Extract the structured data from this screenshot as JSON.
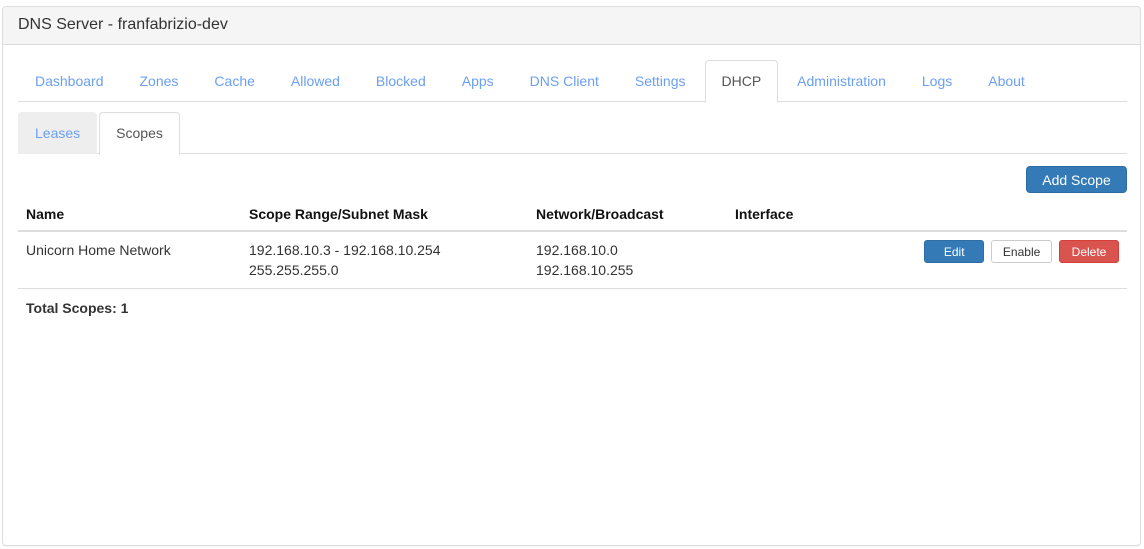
{
  "header": {
    "title": "DNS Server - franfabrizio-dev"
  },
  "main_tabs": [
    {
      "label": "Dashboard",
      "active": false
    },
    {
      "label": "Zones",
      "active": false
    },
    {
      "label": "Cache",
      "active": false
    },
    {
      "label": "Allowed",
      "active": false
    },
    {
      "label": "Blocked",
      "active": false
    },
    {
      "label": "Apps",
      "active": false
    },
    {
      "label": "DNS Client",
      "active": false
    },
    {
      "label": "Settings",
      "active": false
    },
    {
      "label": "DHCP",
      "active": true
    },
    {
      "label": "Administration",
      "active": false
    },
    {
      "label": "Logs",
      "active": false
    },
    {
      "label": "About",
      "active": false
    }
  ],
  "sub_tabs": [
    {
      "label": "Leases",
      "active": false
    },
    {
      "label": "Scopes",
      "active": true
    }
  ],
  "toolbar": {
    "add_scope_label": "Add Scope"
  },
  "table": {
    "columns": [
      "Name",
      "Scope Range/Subnet Mask",
      "Network/Broadcast",
      "Interface",
      ""
    ],
    "rows": [
      {
        "name": "Unicorn Home Network",
        "range": "192.168.10.3 - 192.168.10.254",
        "subnet_mask": "255.255.255.0",
        "network": "192.168.10.0",
        "broadcast": "192.168.10.255",
        "interface": "",
        "actions": {
          "edit": "Edit",
          "enable": "Enable",
          "delete": "Delete"
        }
      }
    ],
    "footer": "Total Scopes: 1"
  },
  "colors": {
    "primary": "#337ab7",
    "danger": "#d9534f",
    "link": "#6b9ff0",
    "heading_bg": "#f5f5f5"
  }
}
